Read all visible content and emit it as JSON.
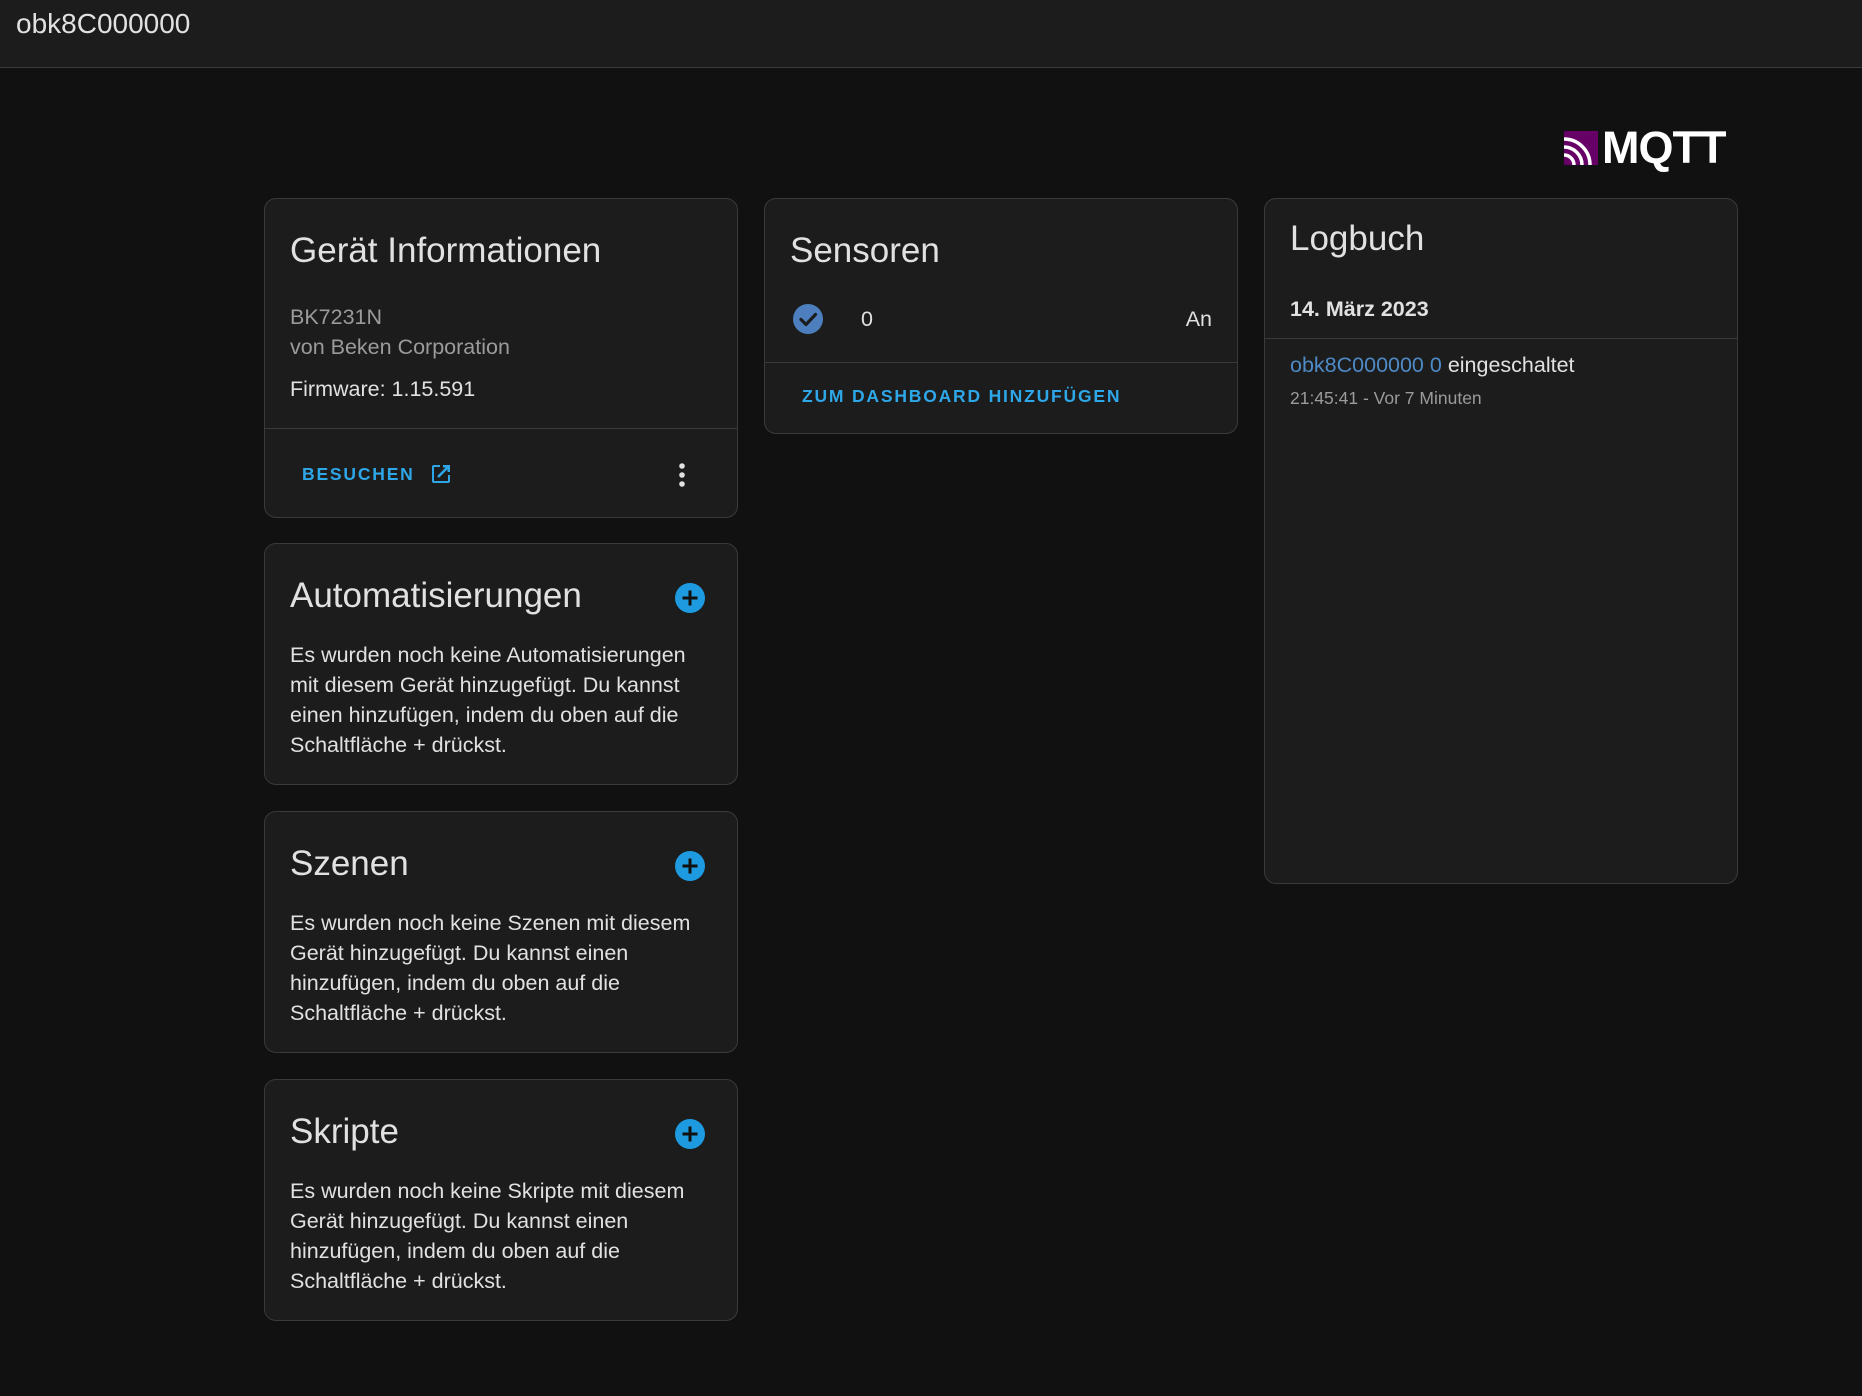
{
  "topbar": {
    "title": "obk8C000000"
  },
  "brand": {
    "logo_text": "MQTT"
  },
  "device_info": {
    "title": "Gerät Informationen",
    "model": "BK7231N",
    "manufacturer": "von Beken Corporation",
    "firmware": "Firmware: 1.15.591",
    "visit_label": "BESUCHEN"
  },
  "automations": {
    "title": "Automatisierungen",
    "text": "Es wurden noch keine Automatisierungen mit diesem Gerät hinzugefügt. Du kannst einen hinzufügen, indem du oben auf die Schaltfläche + drückst."
  },
  "scenes": {
    "title": "Szenen",
    "text": "Es wurden noch keine Szenen mit diesem Gerät hinzugefügt. Du kannst einen hinzufügen, indem du oben auf die Schaltfläche + drückst."
  },
  "scripts": {
    "title": "Skripte",
    "text": "Es wurden noch keine Skripte mit diesem Gerät hinzugefügt. Du kannst einen hinzufügen, indem du oben auf die Schaltfläche + drückst."
  },
  "sensors": {
    "title": "Sensoren",
    "entity_name": "0",
    "entity_state": "An",
    "add_dashboard_label": "ZUM DASHBOARD HINZUFÜGEN"
  },
  "logbook": {
    "title": "Logbuch",
    "date": "14. März 2023",
    "entry_entity": "obk8C000000 0",
    "entry_action": "eingeschaltet",
    "entry_time": "21:45:41 - Vor 7 Minuten"
  },
  "colors": {
    "background": "#111111",
    "card": "#1c1c1c",
    "accent": "#2ea7e8",
    "entity_link": "#4d8ac6",
    "logo_mark": "#660066"
  }
}
